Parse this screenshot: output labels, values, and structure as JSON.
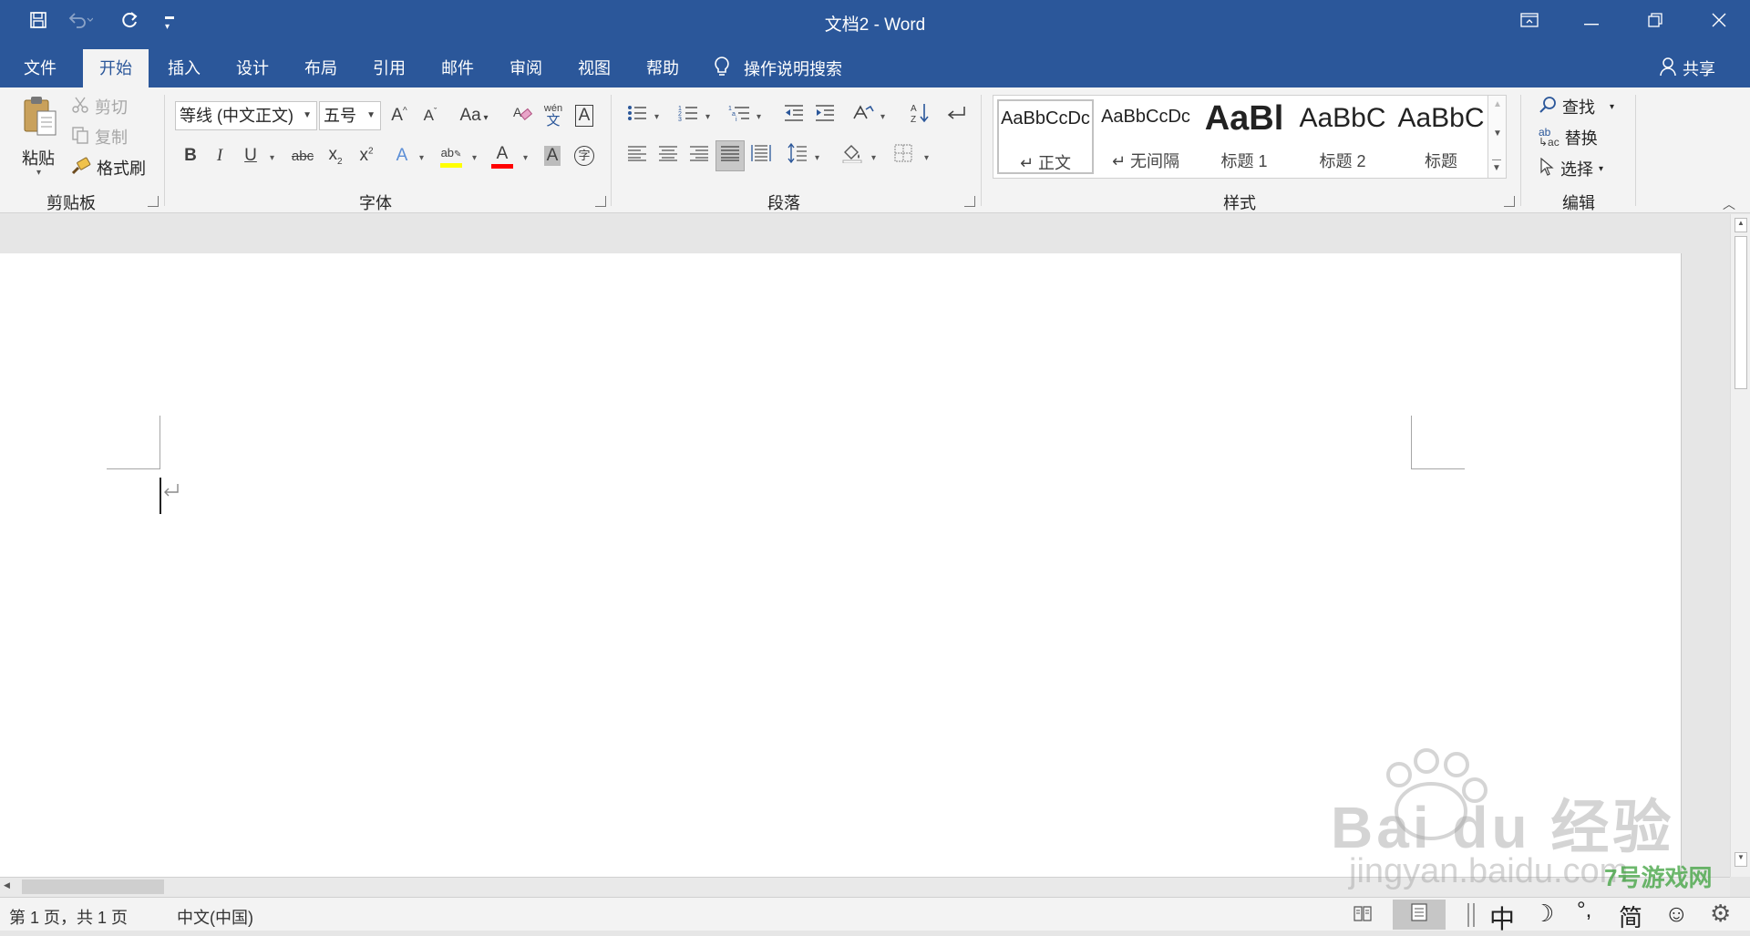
{
  "window": {
    "title": "文档2  -  Word"
  },
  "tabs": [
    {
      "label": "文件",
      "active": false
    },
    {
      "label": "开始",
      "active": true
    },
    {
      "label": "插入",
      "active": false
    },
    {
      "label": "设计",
      "active": false
    },
    {
      "label": "布局",
      "active": false
    },
    {
      "label": "引用",
      "active": false
    },
    {
      "label": "邮件",
      "active": false
    },
    {
      "label": "审阅",
      "active": false
    },
    {
      "label": "视图",
      "active": false
    },
    {
      "label": "帮助",
      "active": false
    }
  ],
  "tell_me": {
    "placeholder": "操作说明搜索"
  },
  "share_label": "共享",
  "clipboard": {
    "paste": "粘贴",
    "cut": "剪切",
    "copy": "复制",
    "format_painter": "格式刷",
    "group_label": "剪贴板"
  },
  "font": {
    "name": "等线 (中文正文)",
    "size": "五号",
    "group_label": "字体",
    "phonetic_top": "wén",
    "phonetic_bottom": "文"
  },
  "paragraph": {
    "group_label": "段落"
  },
  "styles": {
    "group_label": "样式",
    "items": [
      {
        "sample": "AaBbCcDc",
        "name": "正文",
        "selected": true
      },
      {
        "sample": "AaBbCcDc",
        "name": "无间隔",
        "selected": false
      },
      {
        "sample": "AaBl",
        "name": "标题 1",
        "selected": false
      },
      {
        "sample": "AaBbC",
        "name": "标题 2",
        "selected": false
      },
      {
        "sample": "AaBbC",
        "name": "标题",
        "selected": false
      }
    ]
  },
  "editing": {
    "find": "查找",
    "replace": "替换",
    "select": "选择",
    "group_label": "编辑"
  },
  "status": {
    "page_info": "第 1 页，共 1 页",
    "language": "中文(中国)"
  },
  "ime": {
    "mode": "中",
    "punct": "°,",
    "simplified": "简"
  },
  "watermark": {
    "brand": "Bai du 经验",
    "url": "jingyan.baidu.com",
    "badge": "7号游戏网"
  },
  "colors": {
    "accent": "#2b579a",
    "highlight": "#ffff00",
    "font_color": "#ff0000"
  }
}
